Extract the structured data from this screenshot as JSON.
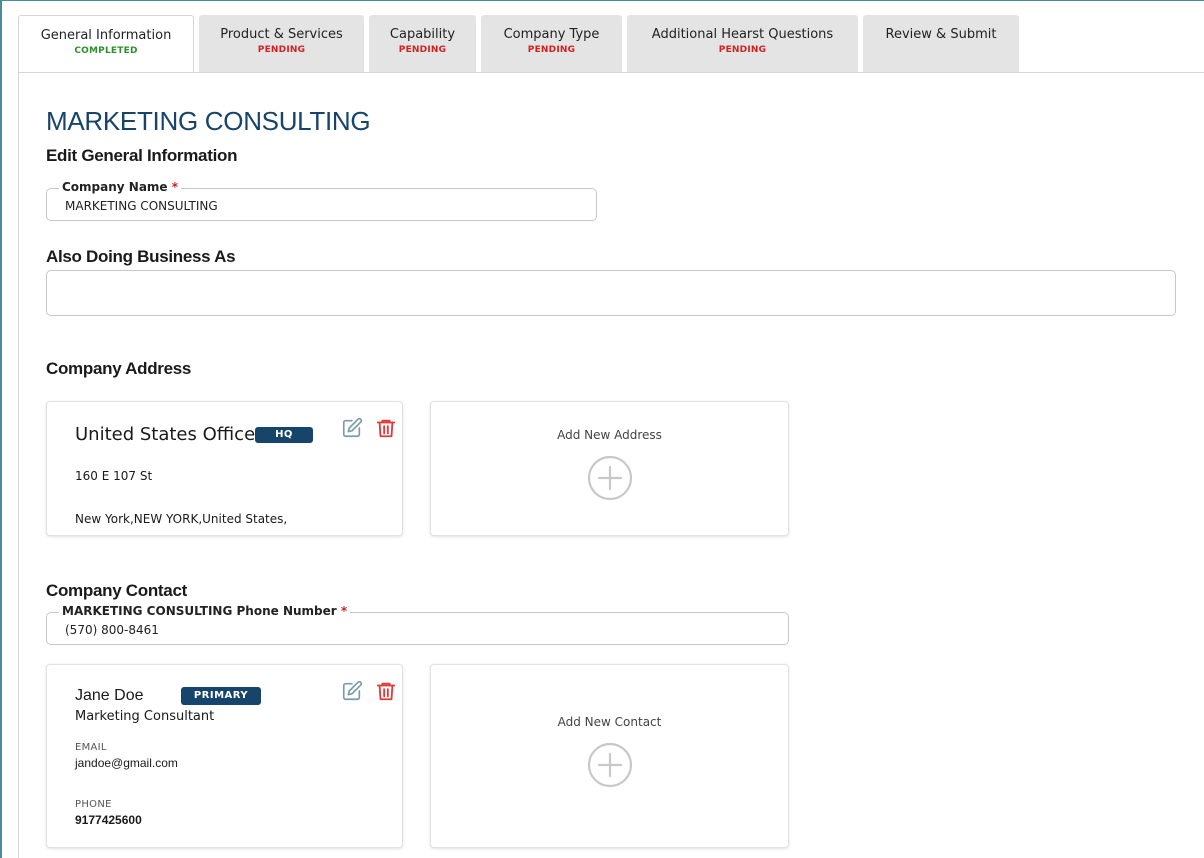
{
  "tabs": [
    {
      "label": "General Information",
      "status": "COMPLETED"
    },
    {
      "label": "Product & Services",
      "status": "PENDING"
    },
    {
      "label": "Capability",
      "status": "PENDING"
    },
    {
      "label": "Company Type",
      "status": "PENDING"
    },
    {
      "label": "Additional Hearst Questions",
      "status": "PENDING"
    },
    {
      "label": "Review & Submit",
      "status": ""
    }
  ],
  "header": {
    "company_title": "MARKETING CONSULTING",
    "subtitle": "Edit General Information"
  },
  "company_name": {
    "label": "Company Name",
    "required_mark": "*",
    "value": "MARKETING CONSULTING"
  },
  "dba": {
    "label": "Also Doing Business As",
    "value": ""
  },
  "address_section": {
    "title": "Company Address",
    "card": {
      "name": "United States Office",
      "badge": "HQ",
      "line1": "160 E 107 St",
      "line2": "New York,NEW YORK,United States,"
    },
    "add_label": "Add New Address"
  },
  "contact_section": {
    "title": "Company Contact",
    "phone_label": "MARKETING CONSULTING Phone Number",
    "required_mark": "*",
    "phone_value": "(570) 800-8461",
    "card": {
      "name": "Jane Doe",
      "badge": "PRIMARY",
      "role": "Marketing Consultant",
      "email_label": "EMAIL",
      "email": "jandoe@gmail.com",
      "phone_label": "PHONE",
      "phone": "9177425600"
    },
    "add_label": "Add New Contact"
  },
  "icons": {
    "edit": "edit-icon",
    "delete": "trash-icon",
    "add": "plus-circle-icon"
  },
  "colors": {
    "brand": "#17446b",
    "completed": "#2f8f2f",
    "pending": "#d42020",
    "edit_icon": "#7a9aad",
    "delete_icon": "#e03a3a"
  }
}
